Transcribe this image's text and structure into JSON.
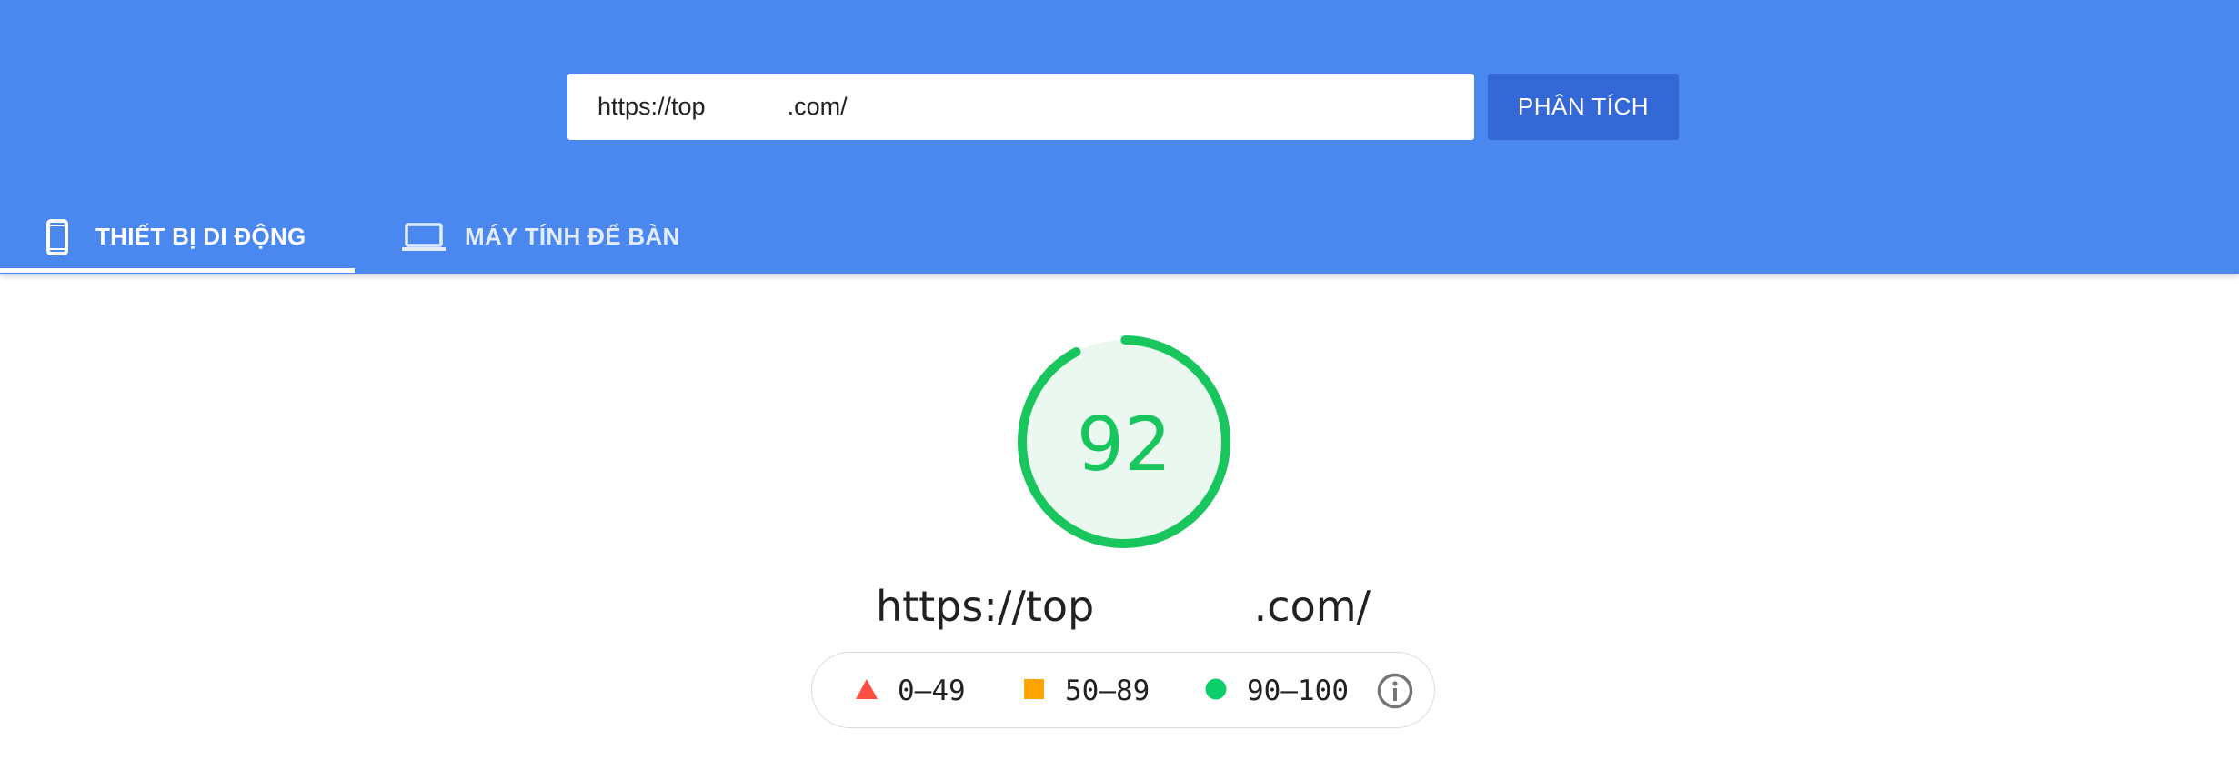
{
  "search": {
    "url_value": "https://top            .com/",
    "analyze_label": "PHÂN TÍCH"
  },
  "tabs": [
    {
      "label": "THIẾT BỊ DI ĐỘNG",
      "icon": "smartphone-icon",
      "active": true
    },
    {
      "label": "MÁY TÍNH ĐỂ BÀN",
      "icon": "laptop-icon",
      "active": false
    }
  ],
  "score": {
    "value": "92",
    "fraction": 0.92,
    "color": "#19c65e"
  },
  "result_url": "https://top            .com/",
  "legend": [
    {
      "range": "0–49",
      "icon": "triangle-icon",
      "color": "#ff4e42"
    },
    {
      "range": "50–89",
      "icon": "square-icon",
      "color": "#ffa400"
    },
    {
      "range": "90–100",
      "icon": "circle-icon",
      "color": "#0cce6b"
    }
  ],
  "colors": {
    "header_bg": "#4a88f0",
    "button_bg": "#3368d6"
  }
}
